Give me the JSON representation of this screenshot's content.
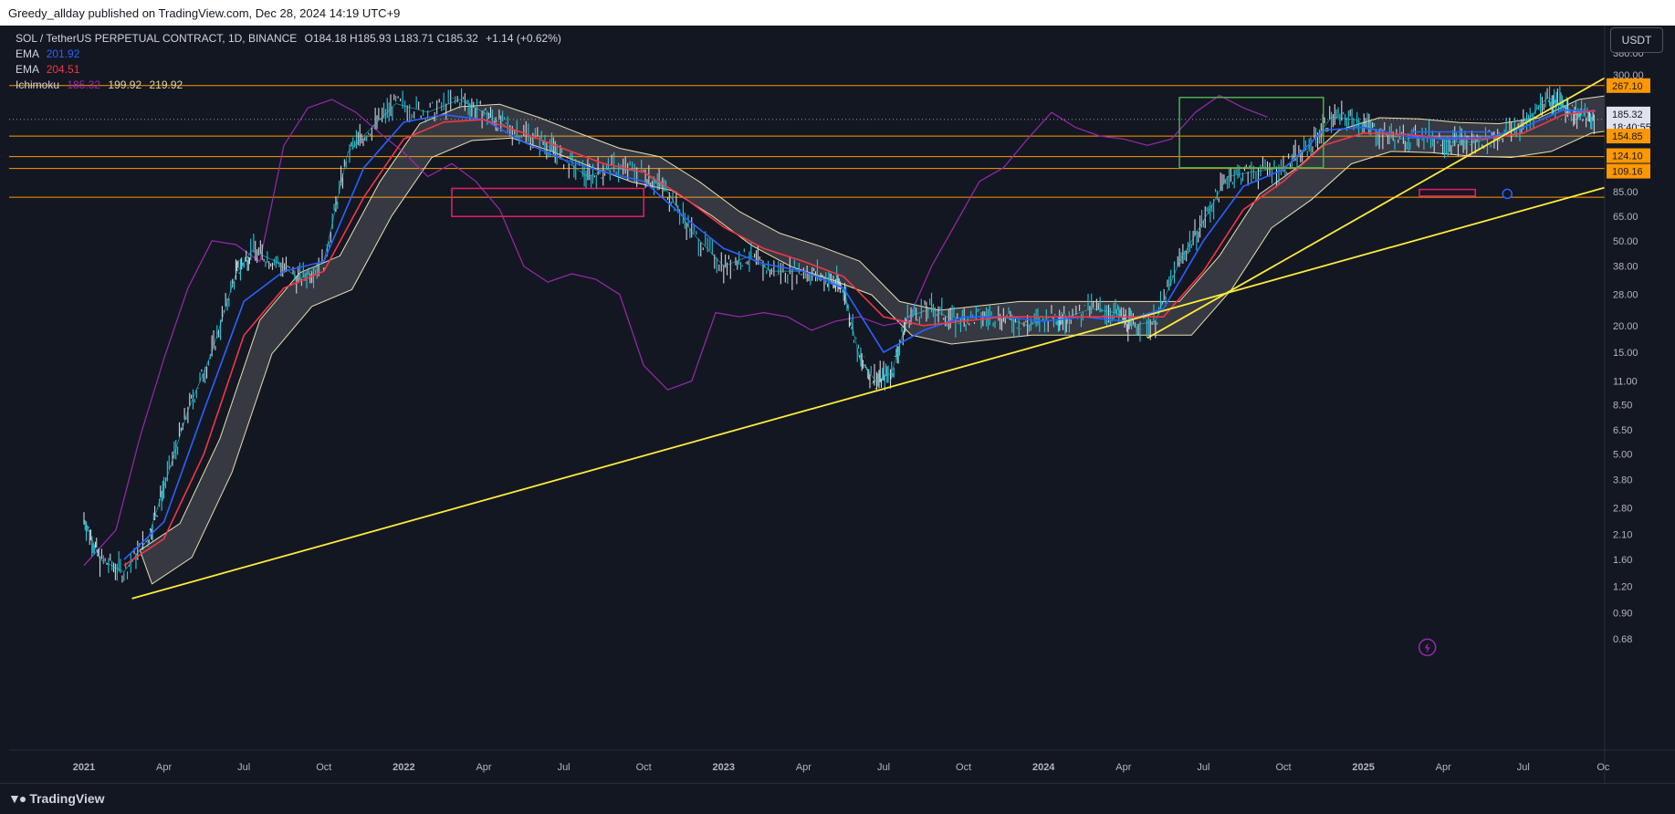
{
  "header": {
    "published_line": "Greedy_allday published on TradingView.com, Dec 28, 2024 14:19 UTC+9"
  },
  "legend": {
    "symbol_line": "SOL / TetherUS PERPETUAL CONTRACT, 1D, BINANCE",
    "ohlc": "O184.18 H185.93 L183.71 C185.32",
    "change": "+1.14 (+0.62%)",
    "ema1_label": "EMA",
    "ema1_value": "201.92",
    "ema2_label": "EMA",
    "ema2_value": "204.51",
    "ichimoku_label": "Ichimoku",
    "ichimoku_v1": "185.32",
    "ichimoku_v2": "199.92",
    "ichimoku_v3": "219.92"
  },
  "currency_button": "USDT",
  "branding": {
    "footer_logo_text": "TradingView"
  },
  "colors": {
    "background": "#131722",
    "candle_up": "#26c6da",
    "candle_down": "#d1d4dc",
    "ema_fast": "#2962ff",
    "ema_slow": "#f23645",
    "chikou": "#9c27b0",
    "cloud": "#e8dfb0",
    "trendline": "#ffeb3b",
    "horizontal_level": "#ff9800",
    "zone_pink": "#e91e63",
    "zone_green": "#4caf50",
    "zone_blue": "#2962ff"
  },
  "chart_data": {
    "type": "line",
    "title": "",
    "xlabel": "",
    "ylabel": "",
    "y_scale": "log",
    "ylim": [
      0.6,
      480
    ],
    "x_ticks": [
      "2021",
      "Apr",
      "Jul",
      "Oct",
      "2022",
      "Apr",
      "Jul",
      "Oct",
      "2023",
      "Apr",
      "Jul",
      "Oct",
      "2024",
      "Apr",
      "Jul",
      "Oct",
      "2025",
      "Apr",
      "Jul",
      "Oc"
    ],
    "y_ticks": [
      "380.00",
      "300.00",
      "200.00",
      "85.00",
      "65.00",
      "50.00",
      "38.00",
      "28.00",
      "20.00",
      "15.00",
      "11.00",
      "8.50",
      "6.50",
      "5.00",
      "3.80",
      "2.80",
      "2.10",
      "1.60",
      "1.20",
      "0.90",
      "0.68"
    ],
    "y_tick_values": [
      380,
      300,
      200,
      85,
      65,
      50,
      38,
      28,
      20,
      15,
      11,
      8.5,
      6.5,
      5,
      3.8,
      2.8,
      2.1,
      1.6,
      1.2,
      0.9,
      0.68
    ],
    "price_labels": [
      {
        "text": "267.10",
        "value": 267.1,
        "style": "level"
      },
      {
        "text": "185.32",
        "value": 185.32,
        "style": "current"
      },
      {
        "text": "18:40:55",
        "value": 185.32,
        "style": "countdown"
      },
      {
        "text": "154.85",
        "value": 154.85,
        "style": "level"
      },
      {
        "text": "124.10",
        "value": 124.1,
        "style": "level"
      },
      {
        "text": "109.16",
        "value": 109.16,
        "style": "level"
      }
    ],
    "horizontal_levels": [
      267.1,
      154.85,
      124.1,
      109.16,
      80
    ],
    "current_price": 185.32,
    "price_series": {
      "name": "SOL",
      "points": [
        [
          0,
          2.5
        ],
        [
          0.2,
          1.6
        ],
        [
          0.5,
          1.4
        ],
        [
          0.8,
          2.0
        ],
        [
          1.0,
          3.5
        ],
        [
          1.3,
          8
        ],
        [
          1.6,
          15
        ],
        [
          1.9,
          35
        ],
        [
          2.1,
          45
        ],
        [
          2.4,
          40
        ],
        [
          2.7,
          33
        ],
        [
          3.0,
          40
        ],
        [
          3.3,
          130
        ],
        [
          3.6,
          170
        ],
        [
          3.9,
          220
        ],
        [
          4.3,
          200
        ],
        [
          4.7,
          230
        ],
        [
          5.0,
          200
        ],
        [
          5.3,
          170
        ],
        [
          5.7,
          150
        ],
        [
          6.0,
          120
        ],
        [
          6.3,
          100
        ],
        [
          6.6,
          110
        ],
        [
          7.0,
          105
        ],
        [
          7.3,
          85
        ],
        [
          7.6,
          55
        ],
        [
          8.0,
          38
        ],
        [
          8.3,
          42
        ],
        [
          8.6,
          36
        ],
        [
          9.0,
          36
        ],
        [
          9.3,
          33
        ],
        [
          9.5,
          30
        ],
        [
          9.7,
          14
        ],
        [
          9.9,
          11
        ],
        [
          10.1,
          12
        ],
        [
          10.3,
          22
        ],
        [
          10.6,
          24
        ],
        [
          10.9,
          21
        ],
        [
          11.2,
          22
        ],
        [
          11.5,
          22
        ],
        [
          11.8,
          20
        ],
        [
          12.1,
          22
        ],
        [
          12.3,
          22
        ],
        [
          12.6,
          24
        ],
        [
          12.9,
          23
        ],
        [
          13.1,
          20
        ],
        [
          13.4,
          21
        ],
        [
          13.7,
          40
        ],
        [
          14.0,
          62
        ],
        [
          14.3,
          100
        ],
        [
          14.6,
          105
        ],
        [
          15.0,
          110
        ],
        [
          15.3,
          135
        ],
        [
          15.6,
          190
        ],
        [
          15.9,
          185
        ],
        [
          16.2,
          160
        ],
        [
          16.5,
          150
        ],
        [
          16.8,
          155
        ],
        [
          17.1,
          145
        ],
        [
          17.4,
          145
        ],
        [
          17.7,
          155
        ],
        [
          18.0,
          175
        ],
        [
          18.3,
          235
        ],
        [
          18.5,
          215
        ],
        [
          18.7,
          195
        ],
        [
          18.9,
          185.32
        ]
      ]
    },
    "ema_fast_points": [
      [
        0.5,
        1.6
      ],
      [
        1.0,
        2.4
      ],
      [
        1.5,
        8
      ],
      [
        2.0,
        26
      ],
      [
        2.5,
        36
      ],
      [
        3.0,
        40
      ],
      [
        3.5,
        110
      ],
      [
        4.0,
        180
      ],
      [
        4.5,
        195
      ],
      [
        5.0,
        185
      ],
      [
        5.5,
        145
      ],
      [
        6.0,
        120
      ],
      [
        6.5,
        105
      ],
      [
        7.0,
        95
      ],
      [
        7.5,
        65
      ],
      [
        8.0,
        46
      ],
      [
        8.5,
        39
      ],
      [
        9.0,
        36
      ],
      [
        9.5,
        30
      ],
      [
        10.0,
        15
      ],
      [
        10.5,
        19
      ],
      [
        11.0,
        22
      ],
      [
        11.5,
        22
      ],
      [
        12.0,
        21
      ],
      [
        12.5,
        22
      ],
      [
        13.0,
        21
      ],
      [
        13.5,
        24
      ],
      [
        14.0,
        50
      ],
      [
        14.5,
        90
      ],
      [
        15.0,
        108
      ],
      [
        15.5,
        165
      ],
      [
        16.0,
        170
      ],
      [
        16.5,
        155
      ],
      [
        17.0,
        150
      ],
      [
        17.5,
        150
      ],
      [
        18.0,
        170
      ],
      [
        18.5,
        205
      ],
      [
        18.9,
        201.92
      ]
    ],
    "ema_slow_points": [
      [
        0.5,
        1.5
      ],
      [
        1.0,
        2.0
      ],
      [
        1.5,
        5
      ],
      [
        2.0,
        18
      ],
      [
        2.5,
        30
      ],
      [
        3.0,
        36
      ],
      [
        3.5,
        80
      ],
      [
        4.0,
        150
      ],
      [
        4.5,
        180
      ],
      [
        5.0,
        185
      ],
      [
        5.5,
        160
      ],
      [
        6.0,
        135
      ],
      [
        6.5,
        115
      ],
      [
        7.0,
        105
      ],
      [
        7.5,
        80
      ],
      [
        8.0,
        58
      ],
      [
        8.5,
        46
      ],
      [
        9.0,
        40
      ],
      [
        9.5,
        34
      ],
      [
        10.0,
        22
      ],
      [
        10.5,
        20
      ],
      [
        11.0,
        21
      ],
      [
        11.5,
        22
      ],
      [
        12.0,
        22
      ],
      [
        12.5,
        22
      ],
      [
        13.0,
        22
      ],
      [
        13.5,
        22
      ],
      [
        14.0,
        36
      ],
      [
        14.5,
        70
      ],
      [
        15.0,
        95
      ],
      [
        15.5,
        140
      ],
      [
        16.0,
        160
      ],
      [
        16.5,
        158
      ],
      [
        17.0,
        152
      ],
      [
        17.5,
        150
      ],
      [
        18.0,
        160
      ],
      [
        18.5,
        195
      ],
      [
        18.9,
        204.51
      ]
    ],
    "chikou_points": [
      [
        0,
        1.5
      ],
      [
        0.4,
        2.2
      ],
      [
        0.7,
        6
      ],
      [
        1.0,
        14
      ],
      [
        1.3,
        30
      ],
      [
        1.6,
        50
      ],
      [
        1.9,
        48
      ],
      [
        2.2,
        40
      ],
      [
        2.5,
        140
      ],
      [
        2.8,
        210
      ],
      [
        3.1,
        230
      ],
      [
        3.4,
        200
      ],
      [
        3.7,
        160
      ],
      [
        4.0,
        130
      ],
      [
        4.3,
        100
      ],
      [
        4.6,
        115
      ],
      [
        4.9,
        95
      ],
      [
        5.2,
        70
      ],
      [
        5.5,
        38
      ],
      [
        5.8,
        32
      ],
      [
        6.1,
        35
      ],
      [
        6.4,
        33
      ],
      [
        6.7,
        28
      ],
      [
        7.0,
        13
      ],
      [
        7.3,
        10
      ],
      [
        7.6,
        11
      ],
      [
        7.9,
        23
      ],
      [
        8.2,
        22
      ],
      [
        8.5,
        23
      ],
      [
        8.8,
        22
      ],
      [
        9.1,
        19
      ],
      [
        9.4,
        21
      ],
      [
        9.7,
        22
      ],
      [
        10.0,
        20
      ],
      [
        10.3,
        21
      ],
      [
        10.6,
        38
      ],
      [
        10.9,
        60
      ],
      [
        11.2,
        95
      ],
      [
        11.5,
        110
      ],
      [
        11.8,
        150
      ],
      [
        12.1,
        200
      ],
      [
        12.4,
        170
      ],
      [
        12.7,
        155
      ],
      [
        13.0,
        150
      ],
      [
        13.3,
        140
      ],
      [
        13.6,
        150
      ],
      [
        13.9,
        200
      ],
      [
        14.2,
        240
      ],
      [
        14.5,
        210
      ],
      [
        14.8,
        190
      ]
    ],
    "trendlines": [
      {
        "from": [
          0.6,
          1.05
        ],
        "to": [
          20.2,
          118
        ]
      },
      {
        "from": [
          13.3,
          17.5
        ],
        "to": [
          20.0,
          470
        ]
      }
    ],
    "zones": [
      {
        "color": "pink",
        "x": [
          4.6,
          7.0
        ],
        "y": [
          65,
          88
        ]
      },
      {
        "color": "green",
        "x": [
          13.7,
          15.5
        ],
        "y": [
          110,
          235
        ]
      },
      {
        "color": "blue",
        "x": [
          16.6,
          17.6
        ],
        "y": [
          152,
          162
        ]
      },
      {
        "color": "pink",
        "x": [
          16.7,
          17.4
        ],
        "y": [
          81,
          87
        ]
      }
    ],
    "markers": [
      {
        "shape": "circle",
        "x": 17.8,
        "y": 83
      },
      {
        "shape": "lightning-icon",
        "x": 16.8,
        "y": 0.62
      }
    ]
  }
}
